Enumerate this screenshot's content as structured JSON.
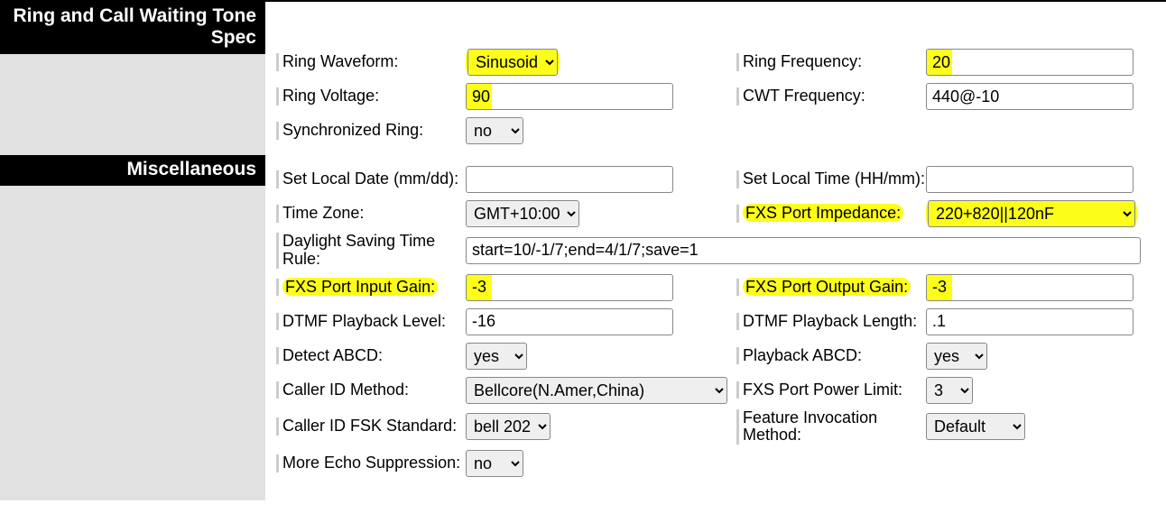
{
  "sections": {
    "ring": "Ring and Call Waiting Tone Spec",
    "misc": "Miscellaneous"
  },
  "ring": {
    "waveform_label": "Ring Waveform:",
    "waveform_value": "Sinusoid",
    "frequency_label": "Ring Frequency:",
    "frequency_value": "20",
    "voltage_label": "Ring Voltage:",
    "voltage_value": "90",
    "cwt_label": "CWT Frequency:",
    "cwt_value": "440@-10",
    "sync_label": "Synchronized Ring:",
    "sync_value": "no"
  },
  "misc": {
    "local_date_label": "Set Local Date (mm/dd):",
    "local_date_value": "",
    "local_time_label": "Set Local Time (HH/mm):",
    "local_time_value": "",
    "tz_label": "Time Zone:",
    "tz_value": "GMT+10:00",
    "impedance_label": "FXS Port Impedance:",
    "impedance_value": "220+820||120nF",
    "dst_label": "Daylight Saving Time Rule:",
    "dst_value": "start=10/-1/7;end=4/1/7;save=1",
    "input_gain_label": "FXS Port Input Gain:",
    "input_gain_value": "-3",
    "output_gain_label": "FXS Port Output Gain:",
    "output_gain_value": "-3",
    "dtmf_level_label": "DTMF Playback Level:",
    "dtmf_level_value": "-16",
    "dtmf_len_label": "DTMF Playback Length:",
    "dtmf_len_value": ".1",
    "detect_abcd_label": "Detect ABCD:",
    "detect_abcd_value": "yes",
    "playback_abcd_label": "Playback ABCD:",
    "playback_abcd_value": "yes",
    "cid_method_label": "Caller ID Method:",
    "cid_method_value": "Bellcore(N.Amer,China)",
    "power_limit_label": "FXS Port Power Limit:",
    "power_limit_value": "3",
    "cid_fsk_label": "Caller ID FSK Standard:",
    "cid_fsk_value": "bell 202",
    "feature_inv_label": "Feature Invocation Method:",
    "feature_inv_value": "Default",
    "echo_label": "More Echo Suppression:",
    "echo_value": "no"
  }
}
